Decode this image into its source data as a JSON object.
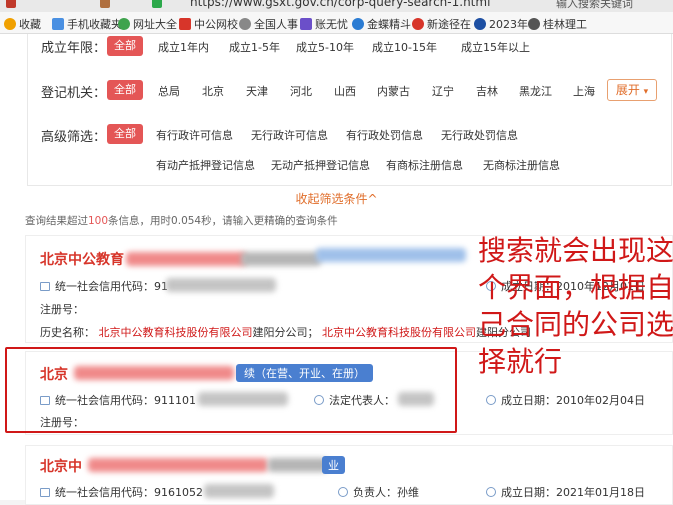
{
  "browser": {
    "url": "https://www.gsxt.gov.cn/corp-query-search-1.html",
    "search_hint": "输入搜索关键词"
  },
  "bookmarks": [
    {
      "label": "收藏",
      "icon": "star-icon",
      "color": "#f0a000"
    },
    {
      "label": "手机收藏夹",
      "icon": "phone-icon",
      "color": "#4a90e2"
    },
    {
      "label": "网址大全",
      "icon": "globe-icon",
      "color": "#3fa34d"
    },
    {
      "label": "中公网校",
      "icon": "brand-icon",
      "color": "#d7352a"
    },
    {
      "label": "全国人事",
      "icon": "globe-icon",
      "color": "#888888"
    },
    {
      "label": "账无忧",
      "icon": "brand-icon",
      "color": "#6b4fc9"
    },
    {
      "label": "金蝶精斗",
      "icon": "brand-icon",
      "color": "#2b7cd3"
    },
    {
      "label": "新途径在",
      "icon": "brand-icon",
      "color": "#d7352a"
    },
    {
      "label": "2023年",
      "icon": "brand-icon",
      "color": "#1d4fa3"
    },
    {
      "label": "桂林理工",
      "icon": "globe-icon",
      "color": "#555555"
    }
  ],
  "filters": {
    "years": {
      "label": "成立年限：",
      "all": "全部",
      "options": [
        "成立1年内",
        "成立1-5年",
        "成立5-10年",
        "成立10-15年",
        "成立15年以上"
      ]
    },
    "registry": {
      "label": "登记机关：",
      "all": "全部",
      "options": [
        "总局",
        "北京",
        "天津",
        "河北",
        "山西",
        "内蒙古",
        "辽宁",
        "吉林",
        "黑龙江",
        "上海"
      ],
      "expand": "展开"
    },
    "advanced": {
      "label": "高级筛选：",
      "all": "全部",
      "options_row1": [
        "有行政许可信息",
        "无行政许可信息",
        "有行政处罚信息",
        "无行政处罚信息"
      ],
      "options_row2": [
        "有动产抵押登记信息",
        "无动产抵押登记信息",
        "有商标注册信息",
        "无商标注册信息"
      ]
    },
    "collapse": "收起筛选条件^"
  },
  "result_info": {
    "prefix": "查询结果超过",
    "count": "100",
    "suffix": "条信息，用时0.054秒，请输入更精确的查询条件"
  },
  "results": [
    {
      "title": "北京中公教育",
      "credit_label": "统一社会信用代码：",
      "credit_value": "91",
      "date_label": "成立日期：",
      "date_value": "2010年12月01日",
      "reg_label": "注册号：",
      "history_label": "历史名称：",
      "history_1a": "北京中公教育科技股份",
      "history_1b": "有限公司",
      "history_1c": "建阳分公司；",
      "history_2a": "北京中公教育科技股份",
      "history_2b": "有限公司",
      "history_2c": "建阳分公司"
    },
    {
      "title": "北京",
      "status": "续（在营、开业、在册）",
      "credit_label": "统一社会信用代码：",
      "credit_value": "911101",
      "rep_label": "法定代表人：",
      "date_label": "成立日期：",
      "date_value": "2010年02月04日",
      "reg_label": "注册号："
    },
    {
      "title": "北京中",
      "status": "业",
      "credit_label": "统一社会信用代码：",
      "credit_value": "9161052",
      "rep_label": "负责人：",
      "rep_value": "孙维",
      "date_label": "成立日期：",
      "date_value": "2021年01月18日"
    }
  ],
  "annotation": "搜索就会出现这个界面，根据自己合同的公司选择就行"
}
